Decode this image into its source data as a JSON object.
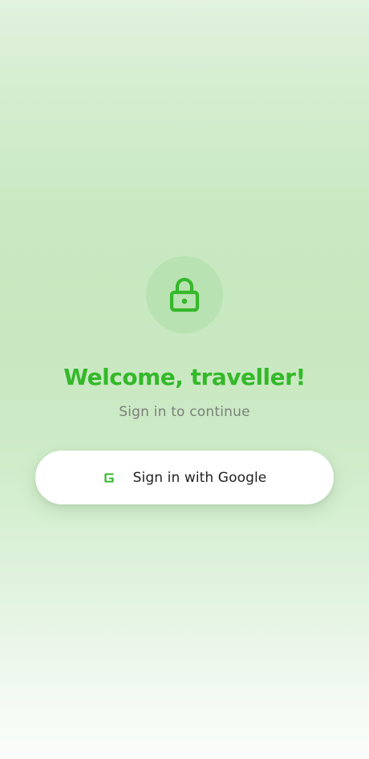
{
  "theme": {
    "accent": "#34b82a",
    "icon_circle": "#b9e2b2",
    "subtitle_color": "#7b7f7b"
  },
  "icons": {
    "header": "lock-icon",
    "button": "google-g-icon"
  },
  "login": {
    "title": "Welcome, traveller!",
    "subtitle": "Sign in to continue",
    "google_button_label": "Sign in with Google"
  }
}
